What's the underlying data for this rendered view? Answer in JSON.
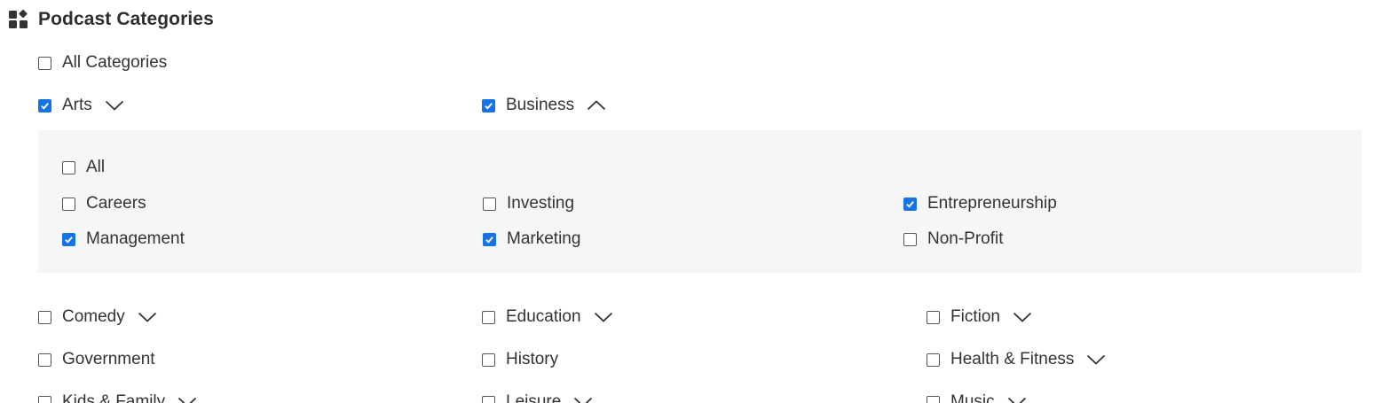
{
  "title": "Podcast Categories",
  "title_icon": "widgets-icon",
  "accent_color": "#1673e6",
  "all_categories": {
    "label": "All Categories",
    "checked": false
  },
  "expanded_row": [
    {
      "label": "Arts",
      "checked": true,
      "chevron": "down"
    },
    {
      "label": "Business",
      "checked": true,
      "chevron": "up"
    }
  ],
  "business_sub": {
    "all": {
      "label": "All",
      "checked": false
    },
    "rows": [
      [
        {
          "label": "Careers",
          "checked": false
        },
        {
          "label": "Investing",
          "checked": false
        },
        {
          "label": "Entrepreneurship",
          "checked": true
        }
      ],
      [
        {
          "label": "Management",
          "checked": true
        },
        {
          "label": "Marketing",
          "checked": true
        },
        {
          "label": "Non-Profit",
          "checked": false
        }
      ]
    ]
  },
  "category_rows": [
    [
      {
        "label": "Comedy",
        "checked": false,
        "chevron": "down"
      },
      {
        "label": "Education",
        "checked": false,
        "chevron": "down"
      },
      {
        "label": "Fiction",
        "checked": false,
        "chevron": "down"
      }
    ],
    [
      {
        "label": "Government",
        "checked": false,
        "chevron": null
      },
      {
        "label": "History",
        "checked": false,
        "chevron": null
      },
      {
        "label": "Health & Fitness",
        "checked": false,
        "chevron": "down"
      }
    ],
    [
      {
        "label": "Kids & Family",
        "checked": false,
        "chevron": "down"
      },
      {
        "label": "Leisure",
        "checked": false,
        "chevron": "down"
      },
      {
        "label": "Music",
        "checked": false,
        "chevron": "down"
      }
    ]
  ]
}
